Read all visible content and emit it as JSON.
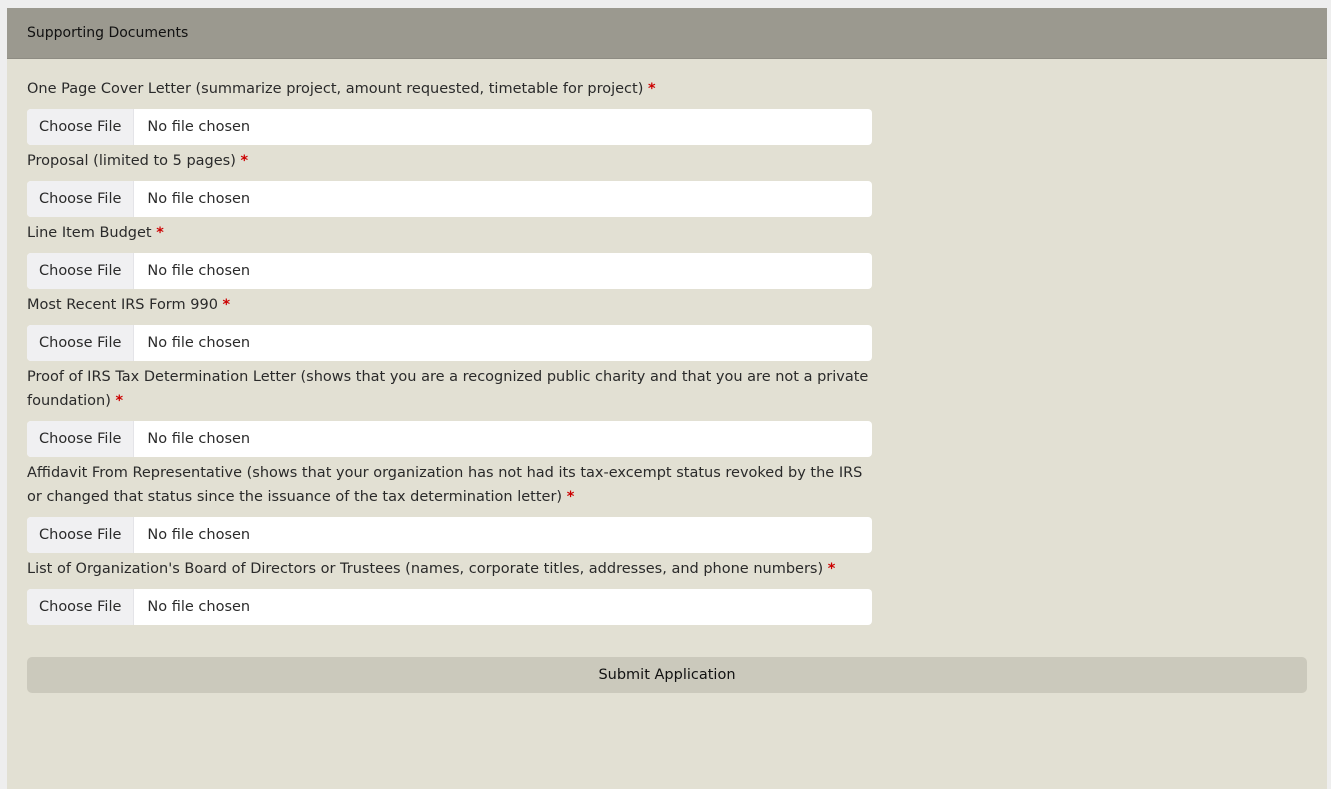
{
  "section": {
    "title": "Supporting Documents"
  },
  "required_marker": "*",
  "fields": [
    {
      "label": "One Page Cover Letter (summarize project, amount requested, timetable for project)",
      "button": "Choose File",
      "status": "No file chosen"
    },
    {
      "label": "Proposal (limited to 5 pages)",
      "button": "Choose File",
      "status": "No file chosen"
    },
    {
      "label": "Line Item Budget",
      "button": "Choose File",
      "status": "No file chosen"
    },
    {
      "label": "Most Recent IRS Form 990",
      "button": "Choose File",
      "status": "No file chosen"
    },
    {
      "label": "Proof of IRS Tax Determination Letter (shows that you are a recognized public charity and that you are not a private foundation)",
      "button": "Choose File",
      "status": "No file chosen"
    },
    {
      "label": "Affidavit From Representative (shows that your organization has not had its tax-excempt status revoked by the IRS or changed that status since the issuance of the tax determination letter)",
      "button": "Choose File",
      "status": "No file chosen"
    },
    {
      "label": "List of Organization's Board of Directors or Trustees (names, corporate titles, addresses, and phone numbers)",
      "button": "Choose File",
      "status": "No file chosen"
    }
  ],
  "submit": {
    "label": "Submit Application"
  },
  "colors": {
    "panel_bg": "#e2e0d3",
    "header_bg": "#9b998f",
    "required": "#cc0000",
    "submit_bg": "#cbc9bc"
  }
}
